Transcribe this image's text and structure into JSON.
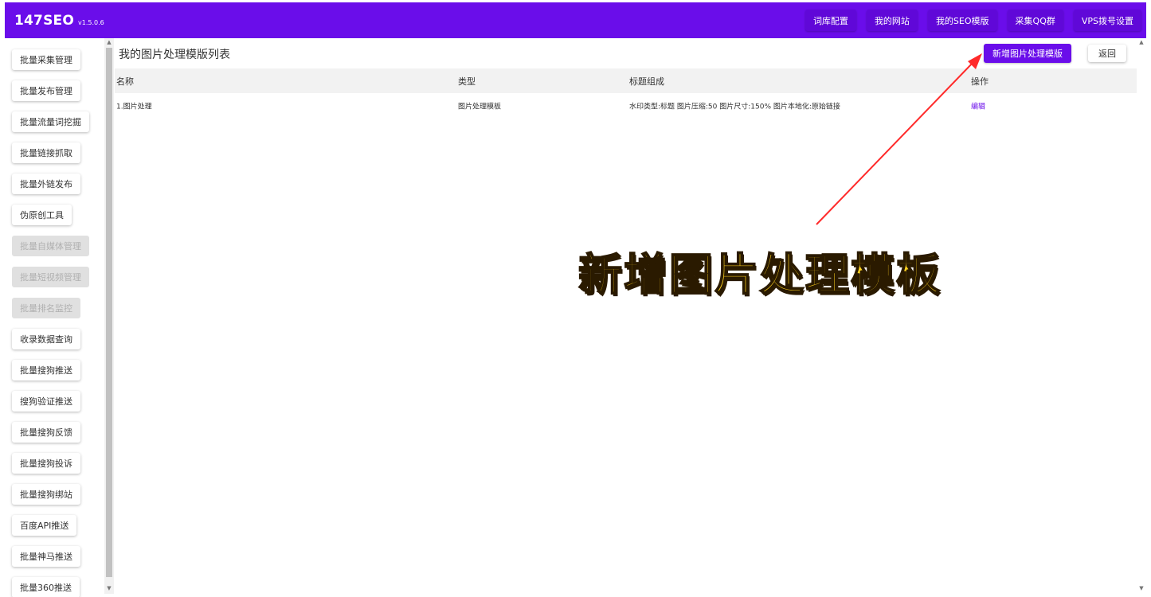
{
  "app": {
    "name": "147SEO",
    "version": "v1.5.0.6"
  },
  "topnav": [
    {
      "label": "词库配置"
    },
    {
      "label": "我的网站"
    },
    {
      "label": "我的SEO模版"
    },
    {
      "label": "采集QQ群"
    },
    {
      "label": "VPS拨号设置"
    }
  ],
  "sidebar": {
    "items": [
      {
        "label": "批量采集管理",
        "enabled": true
      },
      {
        "label": "批量发布管理",
        "enabled": true
      },
      {
        "label": "批量流量词挖掘",
        "enabled": true
      },
      {
        "label": "批量链接抓取",
        "enabled": true
      },
      {
        "label": "批量外链发布",
        "enabled": true
      },
      {
        "label": "伪原创工具",
        "enabled": true
      },
      {
        "label": "批量自媒体管理",
        "enabled": false
      },
      {
        "label": "批量短视频管理",
        "enabled": false
      },
      {
        "label": "批量排名监控",
        "enabled": false
      },
      {
        "label": "收录数据查询",
        "enabled": true
      },
      {
        "label": "批量搜狗推送",
        "enabled": true
      },
      {
        "label": "搜狗验证推送",
        "enabled": true
      },
      {
        "label": "批量搜狗反馈",
        "enabled": true
      },
      {
        "label": "批量搜狗投诉",
        "enabled": true
      },
      {
        "label": "批量搜狗绑站",
        "enabled": true
      },
      {
        "label": "百度API推送",
        "enabled": true
      },
      {
        "label": "批量神马推送",
        "enabled": true
      },
      {
        "label": "批量360推送",
        "enabled": true
      }
    ]
  },
  "main": {
    "title": "我的图片处理模版列表",
    "add_button": "新增图片处理模版",
    "back_button": "返回",
    "table": {
      "headers": [
        "名称",
        "类型",
        "标题组成",
        "操作"
      ],
      "rows": [
        {
          "name": "1.图片处理",
          "type": "图片处理模板",
          "title_composition": "水印类型:标题 图片压缩:50 图片尺寸:150% 图片本地化:原始链接",
          "action": "编辑"
        }
      ]
    }
  },
  "annotation": {
    "text": "新增图片处理模板",
    "arrow_color": "#ff2a2a"
  },
  "colors": {
    "brand": "#6a0dea",
    "annotation_text": "#ffd21f"
  }
}
